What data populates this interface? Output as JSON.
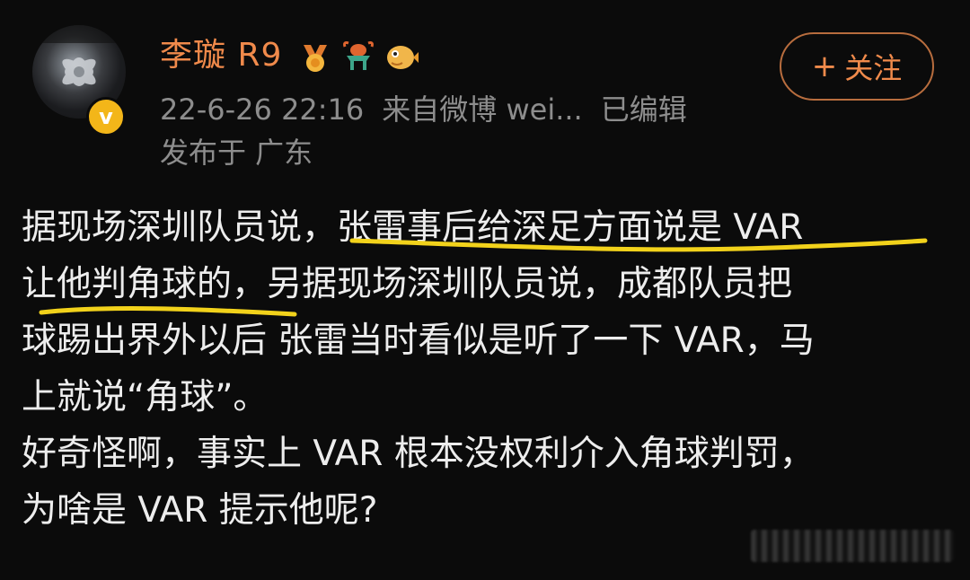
{
  "header": {
    "username": "李璇 R9",
    "timestamp": "22-6-26 22:16",
    "source": "来自微博 wei...",
    "edited": "已编辑",
    "location": "发布于 广东",
    "verified_mark": "v",
    "badges": [
      "medal-icon",
      "lobster-icon",
      "pufferfish-icon"
    ]
  },
  "follow_button": {
    "plus": "+",
    "label": "关注"
  },
  "post": {
    "text": "据现场深圳队员说，张雷事后给深足方面说是 VAR\n让他判角球的，另据现场深圳队员说，成都队员把\n球踢出界外以后 张雷当时看似是听了一下 VAR，马\n上就说“角球”。\n好奇怪啊，事实上 VAR 根本没权利介入角球判罚，\n为啥是 VAR 提示他呢?"
  },
  "colors": {
    "background": "#0b0b0b",
    "username": "#f08a4b",
    "meta": "#8d8d8d",
    "text": "#ededed",
    "underline": "#f2d21b",
    "verified": "#f3b619"
  }
}
